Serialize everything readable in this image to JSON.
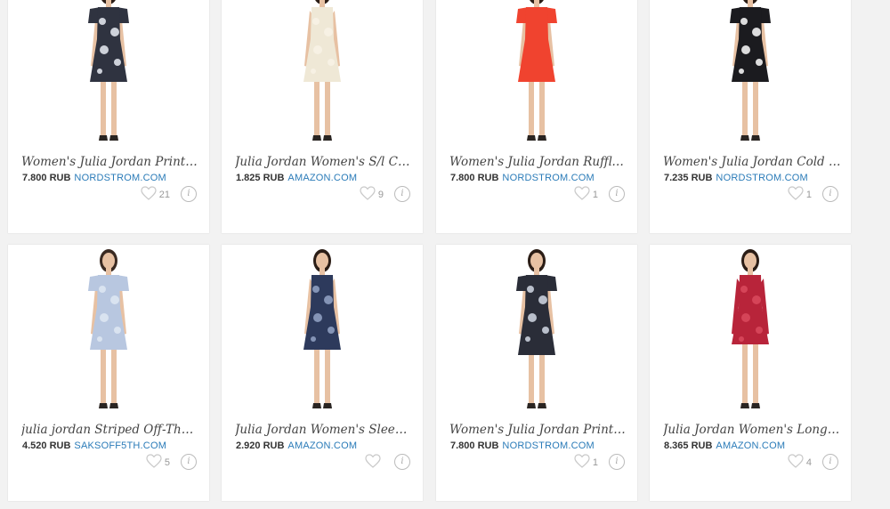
{
  "products": [
    {
      "title": "Women's Julia Jordan Print ...",
      "price": "7.800 RUB",
      "store": "NORDSTROM.COM",
      "likes": "21",
      "dress_color": "#2f3340",
      "dress_accent": "#dfe2ea",
      "icons": {
        "like": "heart-outline-icon",
        "info": "info-circle-icon"
      }
    },
    {
      "title": "Julia Jordan Women's S/l Co...",
      "price": "1.825 RUB",
      "store": "AMAZON.COM",
      "likes": "9",
      "dress_color": "#efe8d6",
      "dress_accent": "#f7f2e6",
      "icons": {
        "like": "heart-outline-icon",
        "info": "info-circle-icon"
      }
    },
    {
      "title": "Women's Julia Jordan Ruffle ...",
      "price": "7.800 RUB",
      "store": "NORDSTROM.COM",
      "likes": "1",
      "dress_color": "#f0432f",
      "dress_accent": "#f0432f",
      "icons": {
        "like": "heart-outline-icon",
        "info": "info-circle-icon"
      }
    },
    {
      "title": "Women's Julia Jordan Cold S...",
      "price": "7.235 RUB",
      "store": "NORDSTROM.COM",
      "likes": "1",
      "dress_color": "#1b1b1f",
      "dress_accent": "#f2f2f2",
      "icons": {
        "like": "heart-outline-icon",
        "info": "info-circle-icon"
      }
    },
    {
      "title": "julia jordan Striped Off-The-...",
      "price": "4.520 RUB",
      "store": "SAKSOFF5TH.COM",
      "likes": "5",
      "dress_color": "#b8c7e0",
      "dress_accent": "#dde6f2",
      "icons": {
        "like": "heart-outline-icon",
        "info": "info-circle-icon"
      }
    },
    {
      "title": "Julia Jordan Women's Sleevel...",
      "price": "2.920 RUB",
      "store": "AMAZON.COM",
      "likes": "",
      "dress_color": "#2d3a5c",
      "dress_accent": "#8e9ec0",
      "icons": {
        "like": "heart-outline-icon",
        "info": "info-circle-icon"
      }
    },
    {
      "title": "Women's Julia Jordan Print ...",
      "price": "7.800 RUB",
      "store": "NORDSTROM.COM",
      "likes": "1",
      "dress_color": "#2a2d38",
      "dress_accent": "#c9cfdc",
      "icons": {
        "like": "heart-outline-icon",
        "info": "info-circle-icon"
      }
    },
    {
      "title": "Julia Jordan Women's Long S...",
      "price": "8.365 RUB",
      "store": "AMAZON.COM",
      "likes": "4",
      "dress_color": "#b8243a",
      "dress_accent": "#d8485c",
      "icons": {
        "like": "heart-outline-icon",
        "info": "info-circle-icon"
      }
    }
  ],
  "colors": {
    "background": "#f2f2f2",
    "card": "#ffffff",
    "store_link": "#2a7bb8",
    "title_text": "#444444",
    "muted": "#999999"
  }
}
